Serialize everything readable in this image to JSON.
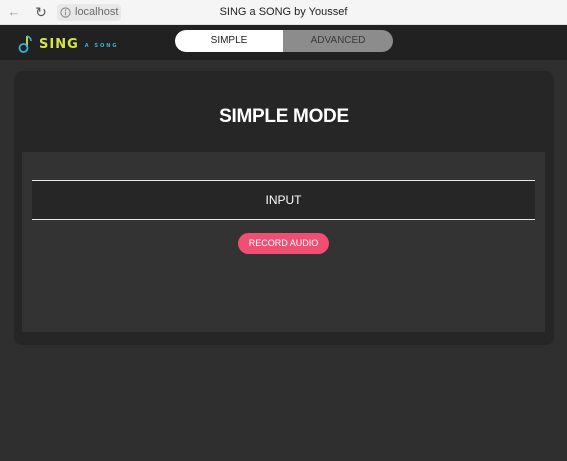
{
  "browser": {
    "url": "localhost",
    "tab_title": "SING a SONG by Youssef"
  },
  "header": {
    "logo_main": "SING",
    "logo_sub": "A SONG",
    "tabs": [
      {
        "label": "SIMPLE",
        "active": true
      },
      {
        "label": "ADVANCED",
        "active": false
      }
    ]
  },
  "main": {
    "title": "SIMPLE MODE",
    "input_label": "INPUT",
    "record_button": "RECORD AUDIO"
  },
  "colors": {
    "accent": "#ef4f73",
    "logo_green": "#d6e34a",
    "logo_blue": "#2fb4d8",
    "background": "#2f2f2f"
  },
  "icons": [
    "back-arrow-icon",
    "reload-icon",
    "site-info-icon",
    "music-note-icon"
  ]
}
